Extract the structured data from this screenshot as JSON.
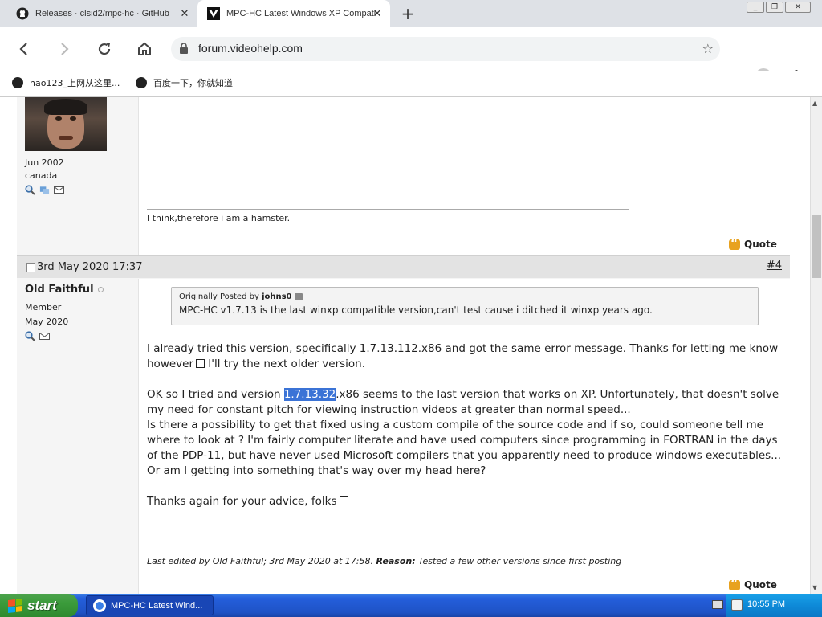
{
  "browser": {
    "tabs": [
      {
        "title": "Releases · clsid2/mpc-hc · GitHub",
        "icon": "github-icon",
        "active": false
      },
      {
        "title": "MPC-HC Latest Windows XP Compati",
        "icon": "videohelp-icon",
        "active": true
      }
    ],
    "new_tab_symbol": "+",
    "window_buttons": {
      "minimize": "_",
      "restore": "❐",
      "close": "✕"
    },
    "url": "forum.videohelp.com",
    "bookmarks": [
      {
        "label": "hao123_上网从这里..."
      },
      {
        "label": "百度一下，你就知道"
      }
    ]
  },
  "previous_post": {
    "join_date": "Jun 2002",
    "location": "canada",
    "signature": "I think,therefore i am a hamster.",
    "quote_label": "Quote"
  },
  "post": {
    "date": "3rd May 2020 17:37",
    "number": "#4",
    "username": "Old Faithful",
    "rank": "Member",
    "join_date": "May 2020",
    "quote": {
      "prefix": "Originally Posted by",
      "author": "johns0",
      "text": "MPC-HC v1.7.13 is the last winxp compatible version,can't test cause i ditched it winxp years ago."
    },
    "paragraph1": "I already tried this version, specifically 1.7.13.112.x86 and got the same error message. Thanks for letting me know however",
    "paragraph1_end": " I'll try the next older version.",
    "paragraph2_before": "OK so I tried and version ",
    "paragraph2_highlight": "1.7.13.32",
    "paragraph2_after": ".x86 seems to the last version that works on XP. Unfortunately, that doesn't solve my need for constant pitch for viewing instruction videos at greater than normal speed...",
    "paragraph3": "Is there a possibility to get that fixed using a custom compile of the source code and if so, could someone tell me where to look at ? I'm fairly computer literate and have used computers since programming in FORTRAN in the days of the PDP-11, but have never used Microsoft compilers that you apparently need to produce windows executables... Or am I getting into something that's way over my head here?",
    "paragraph4": "Thanks again for your advice, folks",
    "edited_prefix": "Last edited by Old Faithful; 3rd May 2020 at 17:58.",
    "edited_reason_label": "Reason:",
    "edited_reason": "Tested a few other versions since first posting",
    "quote_label": "Quote"
  },
  "taskbar": {
    "start_label": "start",
    "window_title": "MPC-HC Latest Wind...",
    "clock": "10:55 PM"
  },
  "colors": {
    "highlight": "#3b73d6",
    "taskbar": "#245edb",
    "start_button": "#3b9b3b",
    "quote_icon": "#e8a21f"
  }
}
